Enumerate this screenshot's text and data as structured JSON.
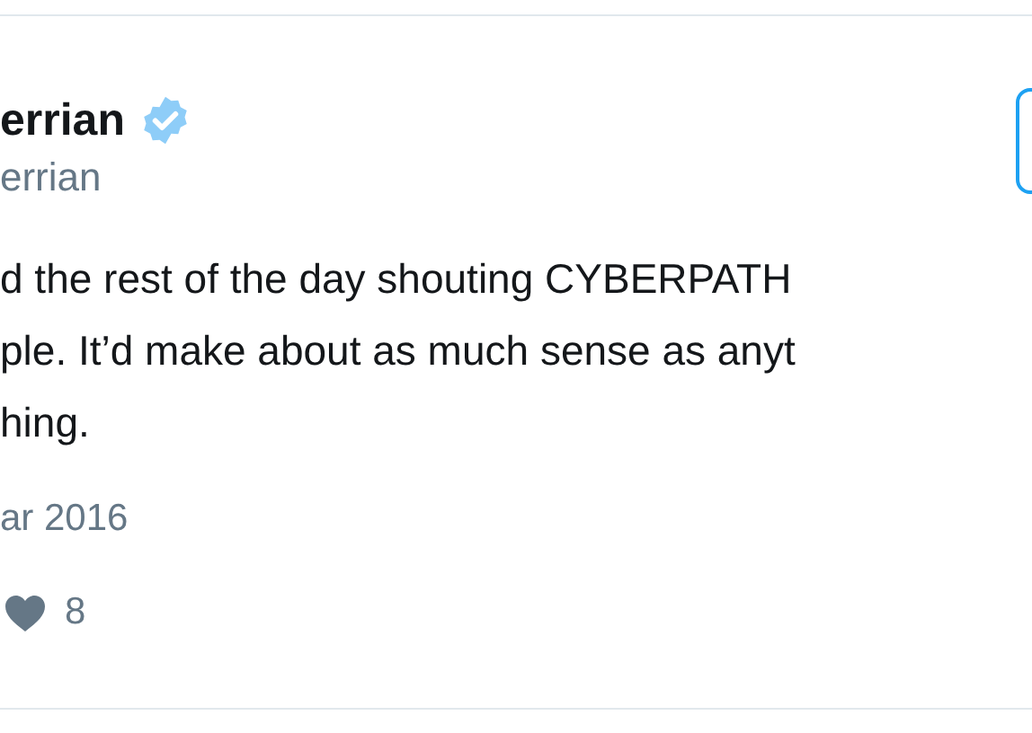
{
  "tweet": {
    "name": "errian",
    "verified": true,
    "handle": "errian",
    "text_lines": [
      "d the rest of the day shouting CYBERPATH",
      "ple. It’d make about as much sense as anyt",
      "hing."
    ],
    "date": "ar 2016",
    "likes": "8"
  }
}
